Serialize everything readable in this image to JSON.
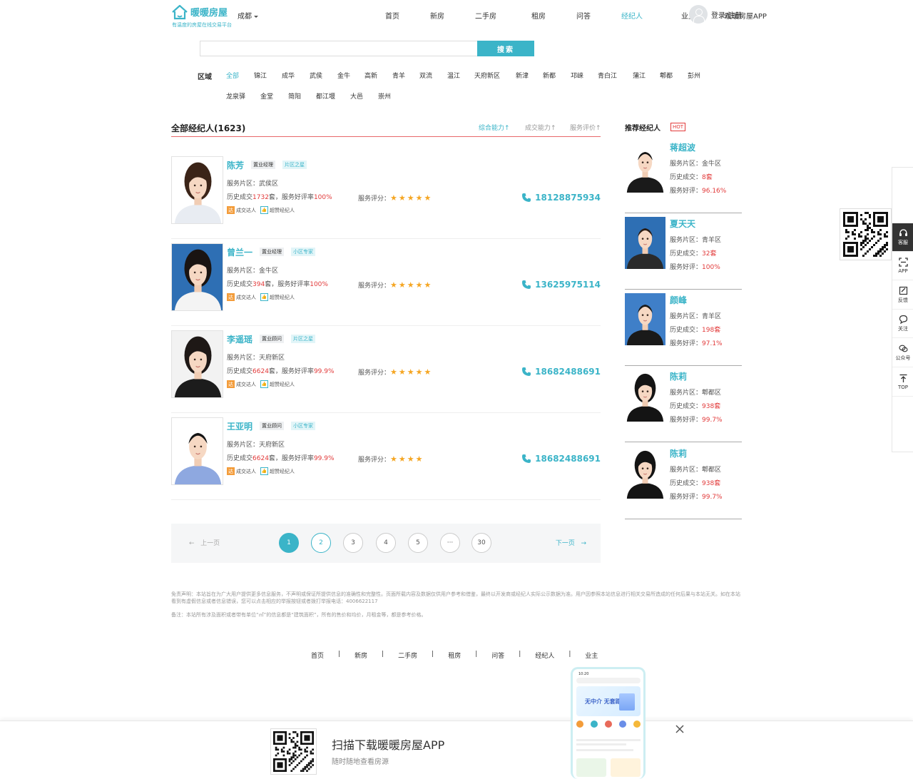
{
  "header": {
    "logo_title": "暖暖房屋",
    "logo_subtitle": "有温度的房屋在线交易平台",
    "city": "成都",
    "nav": [
      {
        "label": "首页",
        "active": false
      },
      {
        "label": "新房",
        "active": false
      },
      {
        "label": "二手房",
        "active": false
      },
      {
        "label": "租房",
        "active": false
      },
      {
        "label": "问答",
        "active": false
      },
      {
        "label": "经纪人",
        "active": true
      },
      {
        "label": "业主",
        "active": false
      },
      {
        "label": "暖暖房屋APP",
        "active": false
      }
    ],
    "login": "登录/注册"
  },
  "search": {
    "placeholder": "",
    "button": "搜索"
  },
  "areas": {
    "label": "区域",
    "items": [
      "全部",
      "锦江",
      "成华",
      "武侯",
      "金牛",
      "高新",
      "青羊",
      "双流",
      "温江",
      "天府新区",
      "新津",
      "新都",
      "邛崃",
      "青白江",
      "蒲江",
      "郫都",
      "彭州",
      "龙泉驿",
      "金堂",
      "简阳",
      "都江堰",
      "大邑",
      "崇州"
    ],
    "active": "全部"
  },
  "list": {
    "title": "全部经纪人(1623)",
    "sorts": [
      {
        "label": "综合能力↑",
        "active": true
      },
      {
        "label": "成交能力↑",
        "active": false
      },
      {
        "label": "服务评价↑",
        "active": false
      }
    ],
    "agents": [
      {
        "name": "陈芳",
        "title": "置业经理",
        "honor": "片区之星",
        "area_label": "服务片区：",
        "area": "武侯区",
        "deals_prefix": "历史成交",
        "deals": "1732",
        "deals_suffix": "套，服务好评率",
        "rate": "100%",
        "badge1": "成交达人",
        "badge2": "超赞经纪人",
        "rating_label": "服务评分：",
        "stars": 5,
        "phone": "18128875934",
        "hair": "#3b2418",
        "shirt": "#e8ecf2",
        "bg": "#ffffff"
      },
      {
        "name": "曾兰一",
        "title": "置业经理",
        "honor": "小区专家",
        "area_label": "服务片区：",
        "area": "金牛区",
        "deals_prefix": "历史成交",
        "deals": "394",
        "deals_suffix": "套，服务好评率",
        "rate": "100%",
        "badge1": "成交达人",
        "badge2": "超赞经纪人",
        "rating_label": "服务评分：",
        "stars": 5,
        "phone": "13625975114",
        "hair": "#1a1412",
        "shirt": "#f4f4f4",
        "bg": "#2e6fb4"
      },
      {
        "name": "李遥瑶",
        "title": "置业顾问",
        "honor": "片区之星",
        "area_label": "服务片区：",
        "area": "天府新区",
        "deals_prefix": "历史成交",
        "deals": "6624",
        "deals_suffix": "套，服务好评率",
        "rate": "99.9%",
        "badge1": "成交达人",
        "badge2": "超赞经纪人",
        "rating_label": "服务评分：",
        "stars": 5,
        "phone": "18682488691",
        "hair": "#1e1816",
        "shirt": "#1c1c1c",
        "bg": "#f2f2f2"
      },
      {
        "name": "王亚明",
        "title": "置业顾问",
        "honor": "小区专家",
        "area_label": "服务片区：",
        "area": "天府新区",
        "deals_prefix": "历史成交",
        "deals": "6624",
        "deals_suffix": "套，服务好评率",
        "rate": "99.9%",
        "badge1": "成交达人",
        "badge2": "超赞经纪人",
        "rating_label": "服务评分：",
        "stars": 4,
        "phone": "18682488691",
        "hair": "#141414",
        "shirt": "#8ea8e0",
        "bg": "#ffffff"
      }
    ]
  },
  "pagination": {
    "prev": "上一页",
    "next": "下一页",
    "pages": [
      "1",
      "2",
      "3",
      "4",
      "5",
      "···",
      "30"
    ],
    "current": "1"
  },
  "recommended": {
    "title": "推荐经纪人",
    "hot": "HOT",
    "agents": [
      {
        "name": "蒋超波",
        "area_label": "服务片区：",
        "area": "金牛区",
        "deals_label": "历史成交：",
        "deals": "8套",
        "rate_label": "服务好评：",
        "rate": "96.16%",
        "hair": "#141414",
        "shirt": "#1a1a1a",
        "bg": "#ffffff"
      },
      {
        "name": "夏天天",
        "area_label": "服务片区：",
        "area": "青羊区",
        "deals_label": "历史成交：",
        "deals": "32套",
        "rate_label": "服务好评：",
        "rate": "100%",
        "hair": "#2a1c14",
        "shirt": "#2a2a2a",
        "bg": "#2e6fb4"
      },
      {
        "name": "颜峰",
        "area_label": "服务片区：",
        "area": "青羊区",
        "deals_label": "历史成交：",
        "deals": "198套",
        "rate_label": "服务好评：",
        "rate": "97.1%",
        "hair": "#1a1a1a",
        "shirt": "#1a1a1a",
        "bg": "#3f7fc8"
      },
      {
        "name": "陈莉",
        "area_label": "服务片区：",
        "area": "郫都区",
        "deals_label": "历史成交：",
        "deals": "938套",
        "rate_label": "服务好评：",
        "rate": "99.7%",
        "hair": "#141414",
        "shirt": "#141414",
        "bg": "#ffffff"
      },
      {
        "name": "陈莉",
        "area_label": "服务片区：",
        "area": "郫都区",
        "deals_label": "历史成交：",
        "deals": "938套",
        "rate_label": "服务好评：",
        "rate": "99.7%",
        "hair": "#141414",
        "shirt": "#141414",
        "bg": "#ffffff"
      }
    ]
  },
  "footer": {
    "disclaimer": "免责声明：本站旨在为广大用户提供更多信息服务，不声明或保证所提供信息的准确性和完整性。页面所载内容及数据仅供用户参考和借鉴，最终以开发商或经纪人实际公示数据为准。用户因参照本站信息进行相关交易所造成的任何后果与本站无关。如在本站看到有虚假信息或者信息错误，您可以点击相应的举报按钮或者拨打举报电话：4006622117",
    "note": "备注：本站所有涉及面积或者带有单位“㎡”的信息都是“建筑面积”，所有的售价和均价，月租金等，都是参考价格。",
    "nav": [
      "首页",
      "新房",
      "二手房",
      "租房",
      "问答",
      "经纪人",
      "业主"
    ]
  },
  "side": {
    "items": [
      {
        "label": "客服",
        "icon": "headset-icon"
      },
      {
        "label": "APP",
        "icon": "scan-icon"
      },
      {
        "label": "反馈",
        "icon": "edit-icon"
      },
      {
        "label": "关注",
        "icon": "heart-chat-icon"
      },
      {
        "label": "公众号",
        "icon": "wechat-icon"
      },
      {
        "label": "TOP",
        "icon": "arrow-top-icon"
      }
    ]
  },
  "banner": {
    "title": "扫描下载暖暖房屋APP",
    "subtitle": "随时随地查看房源",
    "phone_time": "10:20",
    "phone_hero": "无中介 无套路"
  },
  "colors": {
    "accent": "#3bb4c8",
    "red": "#e23a3a",
    "star": "#f5a623",
    "divider": "#e8686b"
  }
}
